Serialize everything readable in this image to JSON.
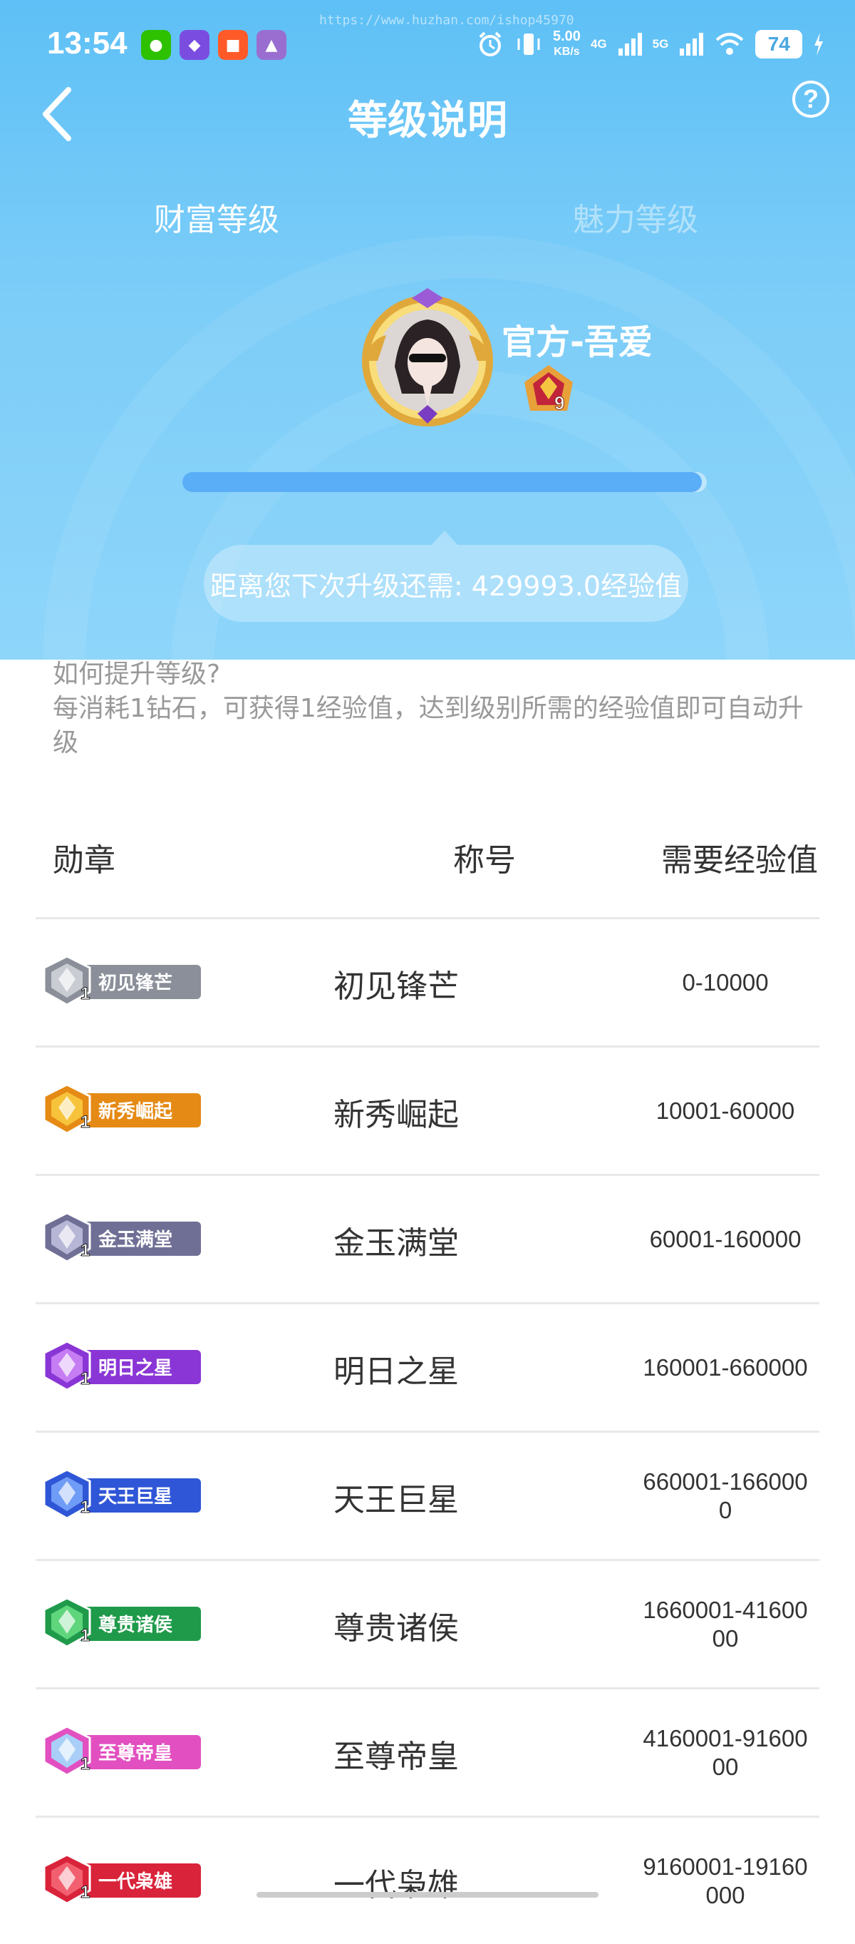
{
  "status_bar": {
    "time": "13:54",
    "watermark": "https://www.huzhan.com/ishop45970",
    "net_speed": "5.00",
    "net_unit": "KB/s",
    "sig1": "4G",
    "sig2": "5G",
    "battery": "74"
  },
  "header": {
    "title": "等级说明",
    "help": "?"
  },
  "tabs": [
    {
      "label": "财富等级",
      "active": true
    },
    {
      "label": "魅力等级",
      "active": false
    }
  ],
  "profile": {
    "name": "官方-吾爱",
    "level": "9",
    "progress_fraction": 0.99,
    "tooltip": "距离您下次升级还需: 429993.0经验值"
  },
  "howto": {
    "question": "如何提升等级?",
    "answer": " 每消耗1钻石，可获得1经验值，达到级别所需的经验值即可自动升级"
  },
  "table": {
    "headers": [
      "勋章",
      "称号",
      "需要经验值"
    ],
    "rows": [
      {
        "badge_text": "初见锋芒",
        "badge_num": "1",
        "title": "初见锋芒",
        "exp": "0-10000",
        "color": "#8a8f99",
        "gem": "#c9ccd3"
      },
      {
        "badge_text": "新秀崛起",
        "badge_num": "1",
        "title": "新秀崛起",
        "exp": "10001-60000",
        "color": "#e58a14",
        "gem": "#f6c33a"
      },
      {
        "badge_text": "金玉满堂",
        "badge_num": "1",
        "title": "金玉满堂",
        "exp": "60001-160000",
        "color": "#6f6f96",
        "gem": "#b7b6d6"
      },
      {
        "badge_text": "明日之星",
        "badge_num": "1",
        "title": "明日之星",
        "exp": "160001-660000",
        "color": "#8a36d6",
        "gem": "#c67cf2"
      },
      {
        "badge_text": "天王巨星",
        "badge_num": "1",
        "title": "天王巨星",
        "exp": "660001-1660000",
        "color": "#2f56d6",
        "gem": "#6f9cf6"
      },
      {
        "badge_text": "尊贵诸侯",
        "badge_num": "1",
        "title": "尊贵诸侯",
        "exp": "1660001-4160000",
        "color": "#1f9a4a",
        "gem": "#5fd57c"
      },
      {
        "badge_text": "至尊帝皇",
        "badge_num": "1",
        "title": "至尊帝皇",
        "exp": "4160001-9160000",
        "color": "#e24fc0",
        "gem": "#a9cff8"
      },
      {
        "badge_text": "一代枭雄",
        "badge_num": "1",
        "title": "一代枭雄",
        "exp": "9160001-19160000",
        "color": "#d9233a",
        "gem": "#f26070"
      }
    ]
  }
}
